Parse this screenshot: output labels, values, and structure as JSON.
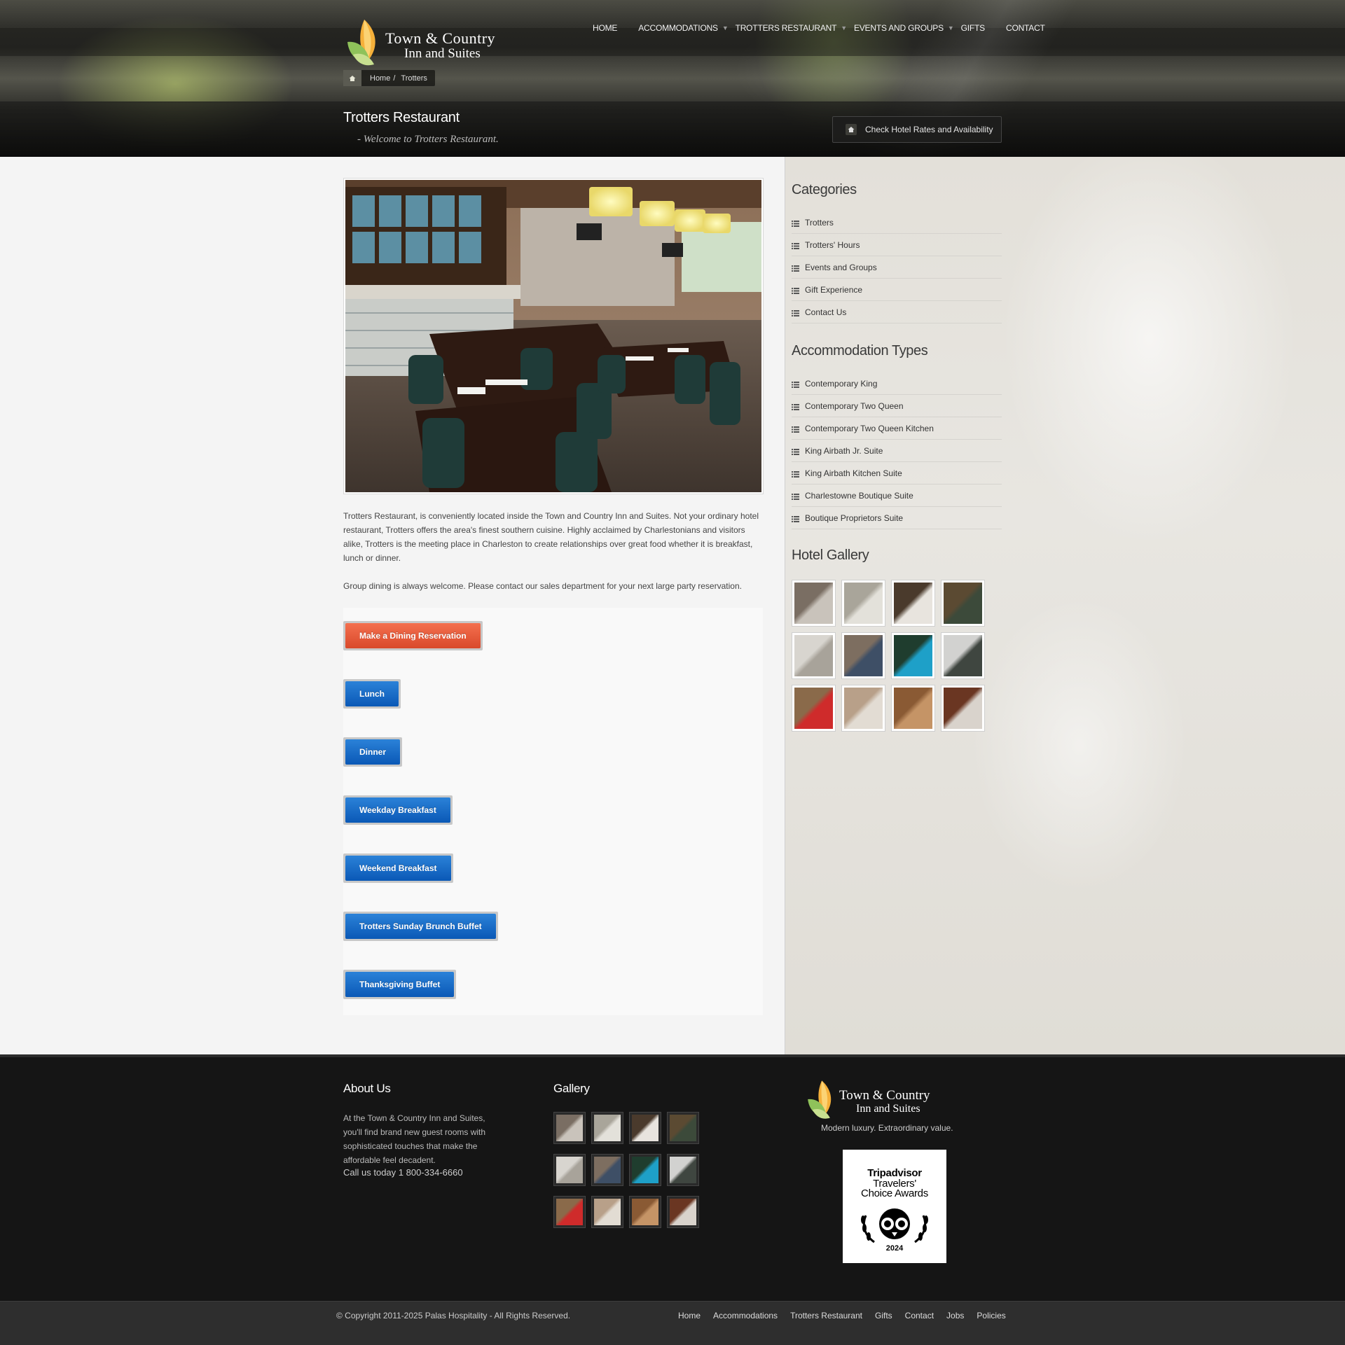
{
  "brand": {
    "name_line1": "Town & Country",
    "name_line2": "Inn and Suites",
    "tagline": "Modern luxury. Extraordinary value."
  },
  "nav": {
    "items": [
      {
        "label": "Home",
        "dropdown": false
      },
      {
        "label": "Accommodations",
        "dropdown": true
      },
      {
        "label": "Trotters Restaurant",
        "dropdown": true
      },
      {
        "label": "Events and Groups",
        "dropdown": true
      },
      {
        "label": "Gifts",
        "dropdown": false
      },
      {
        "label": "Contact",
        "dropdown": false
      }
    ]
  },
  "breadcrumb": {
    "home": "Home",
    "separator": "/",
    "current": "Trotters"
  },
  "page": {
    "title": "Trotters Restaurant",
    "subtitle": "- Welcome to Trotters Restaurant.",
    "rates_button": "Check Hotel Rates and Availability"
  },
  "content": {
    "paragraph1": "Trotters Restaurant, is conveniently located inside the Town and Country Inn and Suites. Not your ordinary hotel restaurant, Trotters offers the area's finest southern cuisine. Highly acclaimed by Charlestonians and visitors alike, Trotters is the meeting place in Charleston to create relationships over great food whether it is breakfast, lunch or dinner.",
    "paragraph2": "Group dining is always welcome. Please contact our sales department for your next large party reservation.",
    "reservation_button": "Make a Dining Reservation",
    "menu_buttons": [
      "Lunch",
      "Dinner",
      "Weekday Breakfast",
      "Weekend Breakfast",
      "Trotters Sunday Brunch Buffet",
      "Thanksgiving Buffet"
    ]
  },
  "sidebar": {
    "categories_title": "Categories",
    "categories": [
      "Trotters",
      "Trotters' Hours",
      "Events and Groups",
      "Gift Experience",
      "Contact Us"
    ],
    "accommodations_title": "Accommodation Types",
    "accommodations": [
      "Contemporary King",
      "Contemporary Two Queen",
      "Contemporary Two Queen Kitchen",
      "King Airbath Jr. Suite",
      "King Airbath Kitchen Suite",
      "Charlestowne Boutique Suite",
      "Boutique Proprietors Suite"
    ],
    "gallery_title": "Hotel Gallery"
  },
  "gallery_colors": [
    [
      "#7a6e63",
      "#c9c3bb"
    ],
    [
      "#a9a59a",
      "#e3e1da"
    ],
    [
      "#4a3a2c",
      "#e8e4de"
    ],
    [
      "#5b4a32",
      "#3c4a3a"
    ],
    [
      "#d8d5cf",
      "#a8a39a"
    ],
    [
      "#7d6e60",
      "#3e4f66"
    ],
    [
      "#1f3d2e",
      "#1ea0c8"
    ],
    [
      "#d2d2d0",
      "#3f4640"
    ],
    [
      "#8a6a4a",
      "#cf2b2b"
    ],
    [
      "#b8a089",
      "#e2dcd3"
    ],
    [
      "#8a5a34",
      "#c59466"
    ],
    [
      "#6a3622",
      "#d9d3cc"
    ]
  ],
  "footer": {
    "about_title": "About Us",
    "about_text": "At the Town & Country Inn and Suites, you'll find brand new guest rooms with sophisticated touches that make the affordable feel decadent.",
    "call_text": "Call us today 1 800-334-6660",
    "gallery_title": "Gallery",
    "award": {
      "brand": "Tripadvisor",
      "line2": "Travelers'",
      "line3": "Choice Awards",
      "year": "2024"
    },
    "copyright": "© Copyright 2011-2025 Palas Hospitality - All Rights Reserved.",
    "links": [
      "Home",
      "Accommodations",
      "Trotters Restaurant",
      "Gifts",
      "Contact",
      "Jobs",
      "Policies"
    ]
  }
}
